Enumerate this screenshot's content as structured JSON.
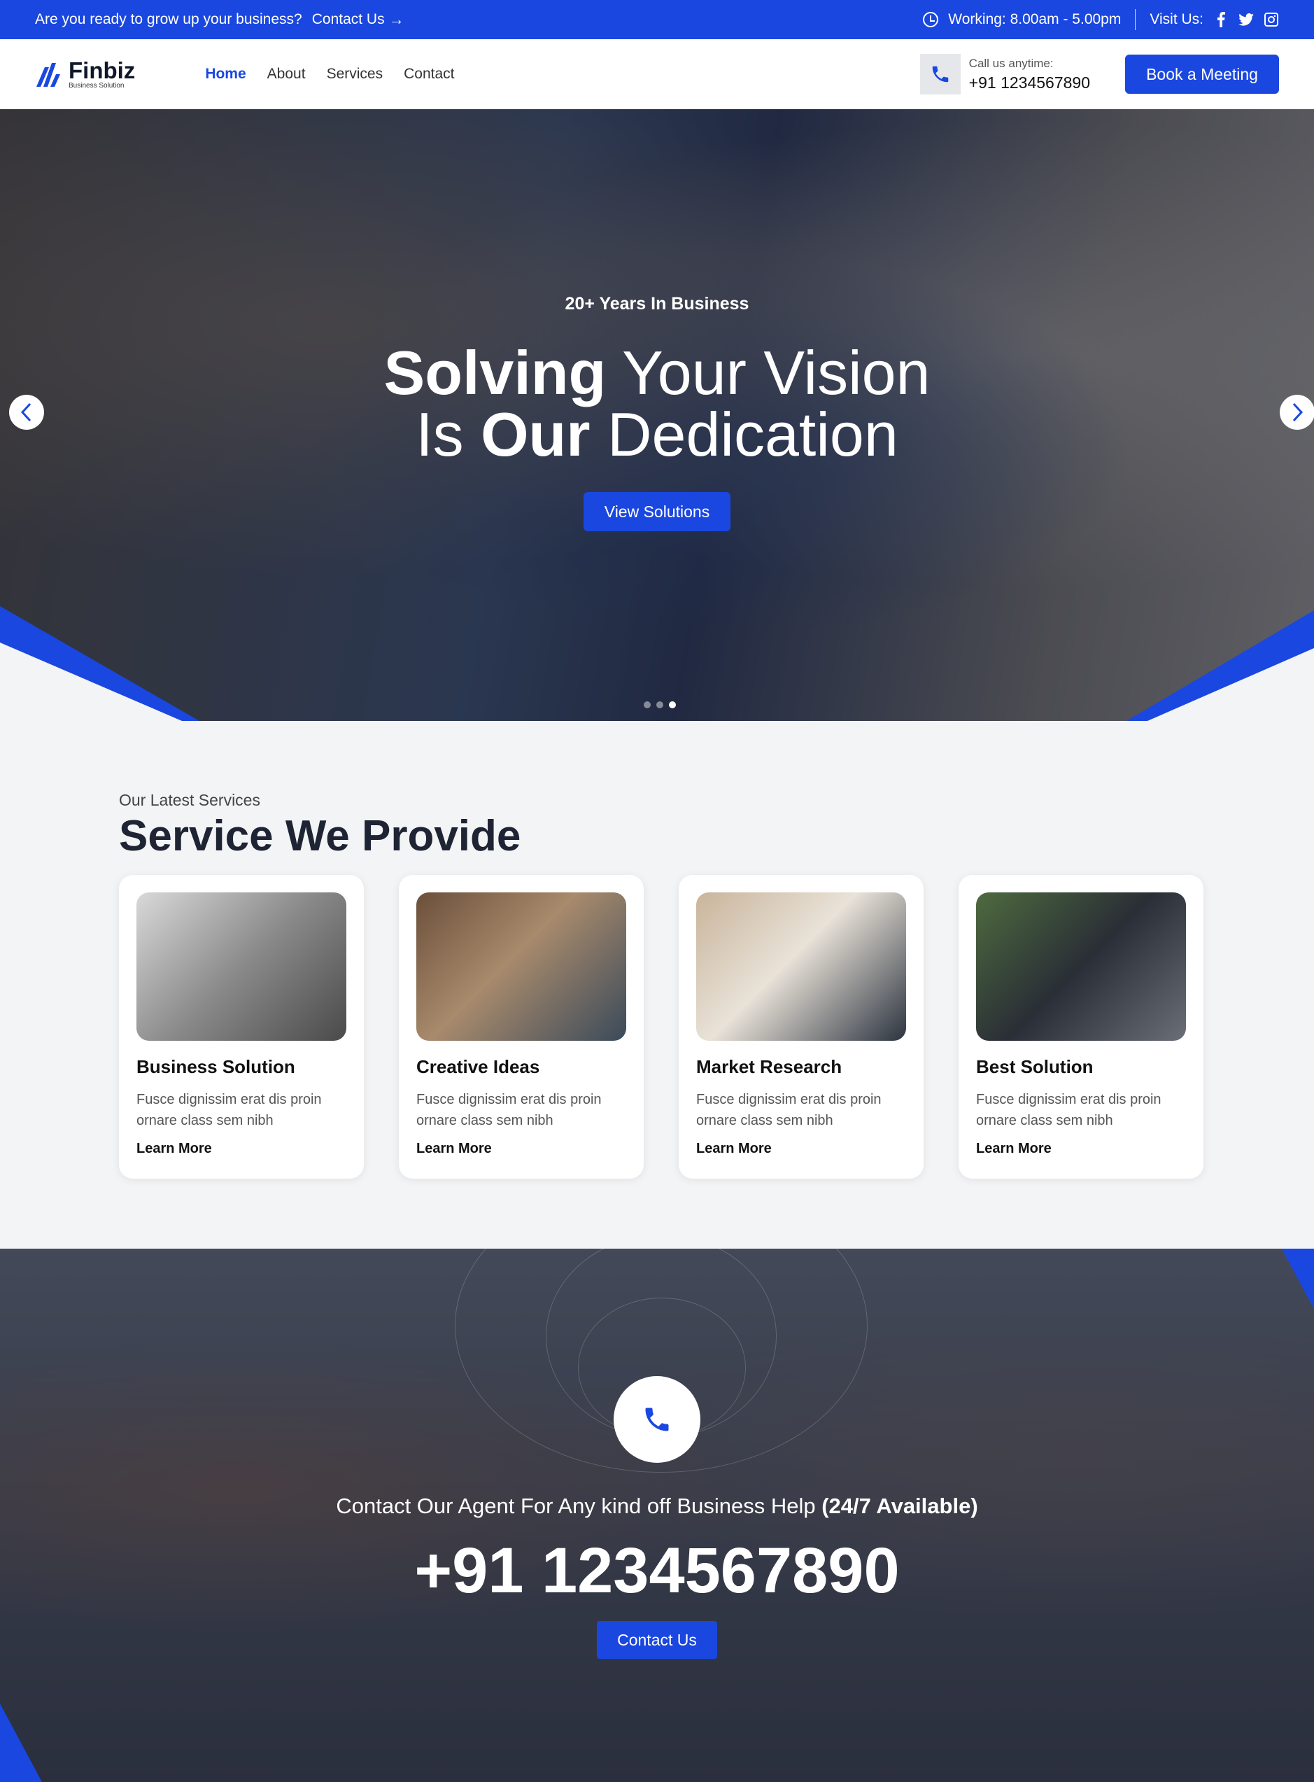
{
  "colors": {
    "accent": "#1a47e0",
    "background": "#f3f4f6",
    "dark_text": "#1e2433"
  },
  "topbar": {
    "prompt": "Are you ready to grow up your business?",
    "contact_link": "Contact Us",
    "working_hours": "Working: 8.00am - 5.00pm",
    "visit_label": "Visit Us:",
    "social_icons": [
      "facebook-icon",
      "twitter-icon",
      "instagram-icon"
    ]
  },
  "header": {
    "logo_name": "Finbiz",
    "logo_tagline": "Business Solution",
    "nav": [
      "Home",
      "About",
      "Services",
      "Contact"
    ],
    "active_nav": "Home",
    "call_label": "Call us anytime:",
    "call_number": "+91 1234567890",
    "cta": "Book a Meeting"
  },
  "hero": {
    "subtitle": "20+ Years In Business",
    "title_line1_bold": "Solving",
    "title_line1_rest": " Your Vision",
    "title_line2_start": "Is ",
    "title_line2_bold": "Our",
    "title_line2_rest": " Dedication",
    "button": "View Solutions",
    "slide_count": 3,
    "active_slide": 3
  },
  "services": {
    "label": "Our Latest Services",
    "title": "Service We Provide",
    "cards": [
      {
        "title": "Business Solution",
        "text": "Fusce dignissim erat dis proin ornare class sem nibh",
        "link": "Learn More"
      },
      {
        "title": "Creative Ideas",
        "text": "Fusce dignissim erat dis proin ornare class sem nibh",
        "link": "Learn More"
      },
      {
        "title": "Market Research",
        "text": "Fusce dignissim erat dis proin ornare class sem nibh",
        "link": "Learn More"
      },
      {
        "title": "Best Solution",
        "text": "Fusce dignissim erat dis proin ornare class sem nibh",
        "link": "Learn More"
      }
    ]
  },
  "contact_band": {
    "text": "Contact Our Agent For Any kind off Business Help",
    "text_bold": "(24/7 Available)",
    "number": "+91 1234567890",
    "button": "Contact Us"
  }
}
